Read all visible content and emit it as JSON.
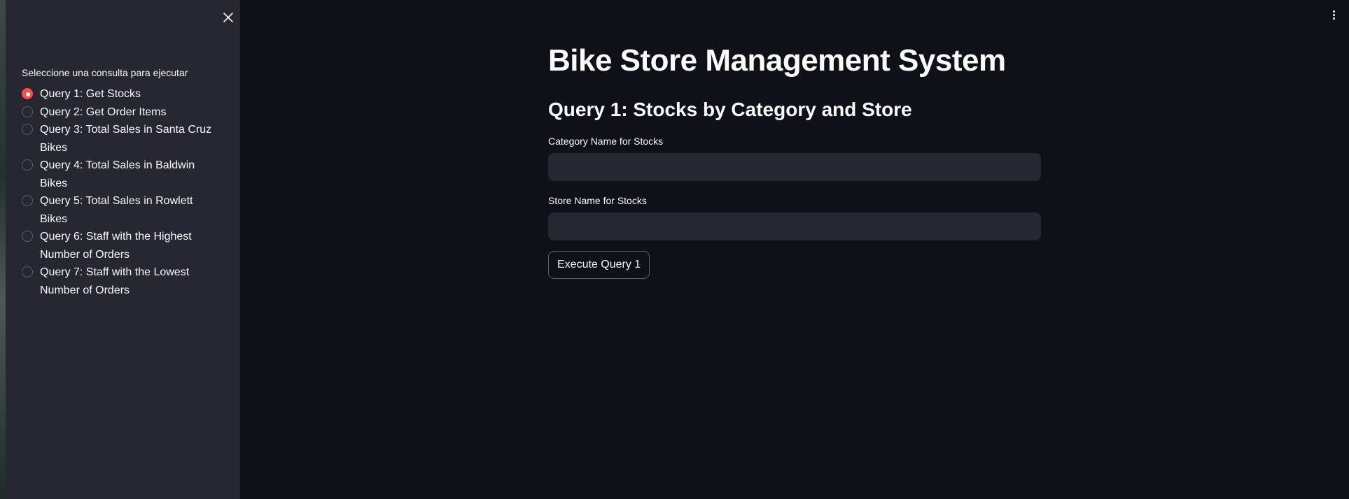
{
  "sidebar": {
    "radio_group_label": "Seleccione una consulta para ejecutar",
    "selected_index": 0,
    "options": [
      "Query 1: Get Stocks",
      "Query 2: Get Order Items",
      "Query 3: Total Sales in Santa Cruz Bikes",
      "Query 4: Total Sales in Baldwin Bikes",
      "Query 5: Total Sales in Rowlett Bikes",
      "Query 6: Staff with the Highest Number of Orders",
      "Query 7: Staff with the Lowest Number of Orders"
    ],
    "close_icon": "close-icon"
  },
  "header": {
    "menu_icon": "vertical-dots-icon"
  },
  "main": {
    "title": "Bike Store Management System",
    "subheader": "Query 1: Stocks by Category and Store",
    "category_label": "Category Name for Stocks",
    "category_value": "",
    "store_label": "Store Name for Stocks",
    "store_value": "",
    "execute_label": "Execute Query 1"
  },
  "colors": {
    "background": "#0e1117",
    "sidebar": "#262730",
    "accent": "#ff4b4b",
    "text": "#fafafa"
  }
}
